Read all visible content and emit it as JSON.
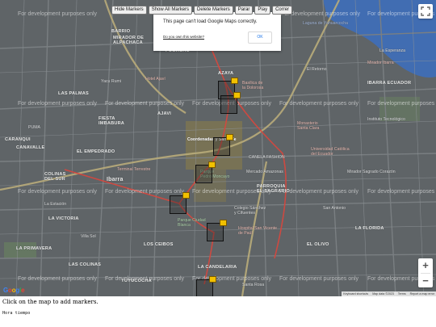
{
  "controls": {
    "hide_markers": "Hide Markers",
    "show_all_markers": "Show All Markers",
    "delete_markers": "Delete Markers",
    "parar": "Parar",
    "play": "Play",
    "correr": "Correr"
  },
  "error_dialog": {
    "message": "This page can't load Google Maps correctly.",
    "own_website": "Do you own this website?",
    "ok": "OK"
  },
  "watermark_text": "For development purposes only",
  "places": {
    "barrio": "BARRIO",
    "mirador_alpachaca": "MIRADOR DE\nALPACHACA",
    "las_palmas": "LAS PALMAS",
    "fiesta_imbaburas": "FIESTA\nIMBABURA",
    "caranqui": "CARANQUI",
    "canavalle": "CANAVALLE",
    "el_empedrado": "EL EMPEDRADO",
    "colinas_del_sur": "COLINAS\nDEL SUR",
    "ibarra": "Ibarra",
    "la_victoria": "LA VICTORIA",
    "azaya": "AZAYA",
    "los_ceibos": "LOS CEIBOS",
    "ajavi": "AJAVI",
    "yuyucocha": "YUYUCOCHA",
    "el_sagrario": "PARROQUIA\nEL SAGRARIO",
    "la_candelaria": "LA CANDELARIA",
    "coordenadas": "Coordenadas y Santa Fe",
    "canela_fashion": "CANELA FASHION",
    "yahuarcocha": "Laguna de Yahuarcocha",
    "basilica": "Basílica de\nla Dolorosa",
    "parque_pedro_moncayo": "Parque\nPedro Moncayo",
    "univ_catolica": "Universidad Católica\ndel Ecuador",
    "monasterio": "Monasterio\nSanta Clara",
    "el_retorno": "El Retorno",
    "la_esperanza": "La Esperanza",
    "mirador_ibarra": "Mirador Ibarra",
    "ibarra_ecuador": "IBARRA ECUADOR",
    "hotel_ajavi": "Hotel Ajaví",
    "yacu_rumi": "Yacu Rumi",
    "puma": "PUMA",
    "la_estacion": "La Estación",
    "terminal": "Terminal Terrestre",
    "mirador_sagrado": "Mirador Sagrado Corazón",
    "instituto": "Instituto Tecnológico",
    "colegio_sanchez": "Colegio Sánchez\ny Cifuentes",
    "parque_ciudad": "Parque Ciudad\nBlanca",
    "la_primavera": "LA PRIMAVERA",
    "villa_sol": "Villa Sol",
    "hospital": "Hospital San Vicente\nde Paúl",
    "mercado": "Mercado Amazonas",
    "las_colinas": "LAS COLINAS",
    "san_antonio": "San Antonio",
    "el_olivo": "EL OLIVO",
    "la_florida": "LA FLORIDA",
    "santa_rosa": "Santa Rosa",
    "pugacho": "PUGACHO"
  },
  "footer": {
    "keyboard_shortcuts": "Keyboard shortcuts",
    "map_data": "Map data ©2023",
    "terms": "Terms",
    "report": "Report a map error"
  },
  "google_logo": "Google",
  "zoom": {
    "in": "+",
    "out": "−"
  },
  "instructions": "Click on the map to add markers.",
  "hora": "Hora tiempo"
}
